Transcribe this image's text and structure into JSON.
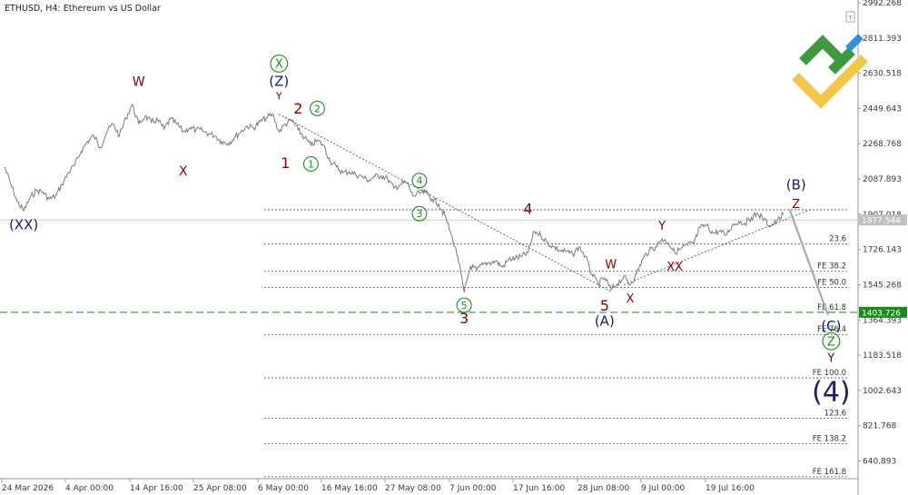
{
  "header": {
    "symbol": "ETHUSD",
    "timeframe": "H4",
    "description": "Ethereum vs US Dollar"
  },
  "colors": {
    "price": "#7a7a7a",
    "dark_red": "#8b0000",
    "navy": "#1a1a6e",
    "green": "#1e8a1e",
    "support_line": "#1a8a1a",
    "projection": "#a9a9a9",
    "logo_green": "#3f9a3f",
    "logo_yellow": "#f2c84b",
    "logo_blue": "#2f8fd8"
  },
  "chart_data": {
    "type": "line",
    "ylim": [
      578.0,
      2992.268
    ],
    "y_ticks": [
      "2992.268",
      "2811.393",
      "2630.518",
      "2449.643",
      "2268.768",
      "2087.893",
      "1907.018",
      "1726.143",
      "1545.268",
      "1364.393",
      "1183.518",
      "1002.643",
      "821.768",
      "640.893"
    ],
    "x_tick_labels": [
      "24 Mar 2026",
      "4 Apr 00:00",
      "14 Apr 16:00",
      "25 Apr 08:00",
      "6 May 00:00",
      "16 May 16:00",
      "27 May 08:00",
      "7 Jun 00:00",
      "17 Jun 16:00",
      "28 Jun 08:00",
      "9 Jul 00:00",
      "19 Jul 16:00"
    ],
    "current_price": "1877.544",
    "support_level": "1403.726",
    "price_series": [
      [
        "03-24 00:00",
        2150
      ],
      [
        "03-25 00:00",
        2060
      ],
      [
        "03-26 00:00",
        1970
      ],
      [
        "03-27 00:00",
        1925
      ],
      [
        "03-28 00:00",
        1990
      ],
      [
        "03-29 00:00",
        2030
      ],
      [
        "03-30 00:00",
        2020
      ],
      [
        "03-31 00:00",
        1985
      ],
      [
        "04-01 00:00",
        2000
      ],
      [
        "04-02 00:00",
        2060
      ],
      [
        "04-03 00:00",
        2120
      ],
      [
        "04-04 00:00",
        2160
      ],
      [
        "04-05 00:00",
        2230
      ],
      [
        "04-06 00:00",
        2280
      ],
      [
        "04-07 00:00",
        2310
      ],
      [
        "04-08 00:00",
        2250
      ],
      [
        "04-09 00:00",
        2330
      ],
      [
        "04-10 00:00",
        2370
      ],
      [
        "04-11 00:00",
        2310
      ],
      [
        "04-12 00:00",
        2400
      ],
      [
        "04-13 00:00",
        2470
      ],
      [
        "04-14 00:00",
        2370
      ],
      [
        "04-15 00:00",
        2410
      ],
      [
        "04-16 00:00",
        2380
      ],
      [
        "04-17 00:00",
        2390
      ],
      [
        "04-18 00:00",
        2345
      ],
      [
        "04-19 00:00",
        2395
      ],
      [
        "04-20 00:00",
        2370
      ],
      [
        "04-21 00:00",
        2330
      ],
      [
        "04-22 00:00",
        2350
      ],
      [
        "04-23 00:00",
        2340
      ],
      [
        "04-24 00:00",
        2335
      ],
      [
        "04-25 00:00",
        2320
      ],
      [
        "04-26 00:00",
        2310
      ],
      [
        "04-27 00:00",
        2280
      ],
      [
        "04-28 00:00",
        2270
      ],
      [
        "04-29 00:00",
        2300
      ],
      [
        "04-30 00:00",
        2330
      ],
      [
        "05-01 00:00",
        2360
      ],
      [
        "05-02 00:00",
        2350
      ],
      [
        "05-03 00:00",
        2380
      ],
      [
        "05-04 00:00",
        2400
      ],
      [
        "05-05 00:00",
        2420
      ],
      [
        "05-06 00:00",
        2330
      ],
      [
        "05-07 00:00",
        2370
      ],
      [
        "05-08 00:00",
        2390
      ],
      [
        "05-09 00:00",
        2340
      ],
      [
        "05-10 00:00",
        2300
      ],
      [
        "05-11 00:00",
        2260
      ],
      [
        "05-12 00:00",
        2285
      ],
      [
        "05-13 00:00",
        2260
      ],
      [
        "05-14 00:00",
        2180
      ],
      [
        "05-15 00:00",
        2150
      ],
      [
        "05-16 00:00",
        2120
      ],
      [
        "05-17 00:00",
        2125
      ],
      [
        "05-18 00:00",
        2110
      ],
      [
        "05-19 00:00",
        2100
      ],
      [
        "05-20 00:00",
        2080
      ],
      [
        "05-21 00:00",
        2100
      ],
      [
        "05-22 00:00",
        2105
      ],
      [
        "05-23 00:00",
        2090
      ],
      [
        "05-24 00:00",
        2040
      ],
      [
        "05-25 00:00",
        2060
      ],
      [
        "05-26 00:00",
        2070
      ],
      [
        "05-27 00:00",
        2000
      ],
      [
        "05-28 00:00",
        2015
      ],
      [
        "05-29 00:00",
        2020
      ],
      [
        "05-30 00:00",
        1985
      ],
      [
        "05-31 00:00",
        1960
      ],
      [
        "06-01 00:00",
        1900
      ],
      [
        "06-02 00:00",
        1800
      ],
      [
        "06-03 00:00",
        1690
      ],
      [
        "06-04 00:00",
        1505
      ],
      [
        "06-05 00:00",
        1640
      ],
      [
        "06-06 00:00",
        1620
      ],
      [
        "06-07 00:00",
        1650
      ],
      [
        "06-08 00:00",
        1660
      ],
      [
        "06-09 00:00",
        1665
      ],
      [
        "06-10 00:00",
        1635
      ],
      [
        "06-11 00:00",
        1675
      ],
      [
        "06-12 00:00",
        1680
      ],
      [
        "06-13 00:00",
        1690
      ],
      [
        "06-14 00:00",
        1710
      ],
      [
        "06-15 00:00",
        1820
      ],
      [
        "06-16 00:00",
        1800
      ],
      [
        "06-17 00:00",
        1760
      ],
      [
        "06-18 00:00",
        1740
      ],
      [
        "06-19 00:00",
        1720
      ],
      [
        "06-20 00:00",
        1715
      ],
      [
        "06-21 00:00",
        1700
      ],
      [
        "06-22 00:00",
        1740
      ],
      [
        "06-23 00:00",
        1690
      ],
      [
        "06-24 00:00",
        1600
      ],
      [
        "06-25 00:00",
        1550
      ],
      [
        "06-26 00:00",
        1580
      ],
      [
        "06-27 00:00",
        1520
      ],
      [
        "06-28 00:00",
        1550
      ],
      [
        "06-29 00:00",
        1585
      ],
      [
        "06-30 00:00",
        1545
      ],
      [
        "07-01 00:00",
        1600
      ],
      [
        "07-02 00:00",
        1680
      ],
      [
        "07-03 00:00",
        1720
      ],
      [
        "07-04 00:00",
        1740
      ],
      [
        "07-05 00:00",
        1780
      ],
      [
        "07-06 00:00",
        1760
      ],
      [
        "07-07 00:00",
        1710
      ],
      [
        "07-08 00:00",
        1730
      ],
      [
        "07-09 00:00",
        1750
      ],
      [
        "07-10 00:00",
        1760
      ],
      [
        "07-11 00:00",
        1840
      ],
      [
        "07-12 00:00",
        1850
      ],
      [
        "07-13 00:00",
        1810
      ],
      [
        "07-14 00:00",
        1820
      ],
      [
        "07-15 00:00",
        1800
      ],
      [
        "07-16 00:00",
        1850
      ],
      [
        "07-17 00:00",
        1870
      ],
      [
        "07-18 00:00",
        1860
      ],
      [
        "07-19 00:00",
        1890
      ],
      [
        "07-20 00:00",
        1910
      ],
      [
        "07-21 00:00",
        1880
      ],
      [
        "07-22 00:00",
        1845
      ],
      [
        "07-23 00:00",
        1870
      ],
      [
        "07-24 00:00",
        1905
      ]
    ],
    "fib_levels": [
      {
        "label": "",
        "value": 1930
      },
      {
        "label": "23.6",
        "value": 1754
      },
      {
        "label": "FE 38.2",
        "value": 1614
      },
      {
        "label": "FE 50.0",
        "value": 1531
      },
      {
        "label": "FE 61.8",
        "value": 1403.726
      },
      {
        "label": "FE 76.4",
        "value": 1290
      },
      {
        "label": "FE 100.0",
        "value": 1067
      },
      {
        "label": "123.6",
        "value": 860
      },
      {
        "label": "FE 138.2",
        "value": 730
      },
      {
        "label": "FE 161.8",
        "value": 560
      }
    ],
    "trendlines": [
      {
        "style": "dotted",
        "from": [
          "05-06 00:00",
          2420
        ],
        "to": [
          "06-27 00:00",
          1510
        ]
      },
      {
        "style": "dotted",
        "from": [
          "06-29 00:00",
          1545
        ],
        "to": [
          "07-28 12:00",
          1935
        ]
      },
      {
        "style": "projection",
        "from": [
          "07-25 00:00",
          1930
        ],
        "to": [
          "07-31 00:00",
          1390
        ]
      }
    ],
    "wave_labels": [
      {
        "text": "W",
        "color": "dark_red",
        "style": "text",
        "size": 14,
        "t": "04-14 00:00",
        "v": 2590
      },
      {
        "text": "X",
        "color": "dark_red",
        "style": "text",
        "size": 14,
        "t": "04-21 00:00",
        "v": 2130
      },
      {
        "text": "(XX)",
        "color": "navy",
        "style": "text",
        "size": 15,
        "t": "03-27 00:00",
        "v": 1855
      },
      {
        "text": "X",
        "color": "green",
        "style": "circle",
        "size": 13,
        "t": "05-06 00:00",
        "v": 2680
      },
      {
        "text": "(Z)",
        "color": "navy",
        "style": "text",
        "size": 15,
        "t": "05-06 00:00",
        "v": 2590
      },
      {
        "text": "Y",
        "color": "dark_red",
        "style": "text",
        "size": 11,
        "t": "05-06 00:00",
        "v": 2515
      },
      {
        "text": "2",
        "color": "dark_red",
        "style": "text",
        "size": 16,
        "t": "05-09 00:00",
        "v": 2450
      },
      {
        "text": "2",
        "color": "green",
        "style": "circle",
        "size": 11,
        "t": "05-12 00:00",
        "v": 2450
      },
      {
        "text": "1",
        "color": "dark_red",
        "style": "text",
        "size": 16,
        "t": "05-07 00:00",
        "v": 2170
      },
      {
        "text": "1",
        "color": "green",
        "style": "circle",
        "size": 11,
        "t": "05-11 00:00",
        "v": 2165
      },
      {
        "text": "4",
        "color": "green",
        "style": "circle",
        "size": 11,
        "t": "05-28 00:00",
        "v": 2080
      },
      {
        "text": "3",
        "color": "green",
        "style": "circle",
        "size": 11,
        "t": "05-28 00:00",
        "v": 1910
      },
      {
        "text": "4",
        "color": "dark_red",
        "style": "text",
        "size": 16,
        "t": "06-14 00:00",
        "v": 1935
      },
      {
        "text": "5",
        "color": "green",
        "style": "circle",
        "size": 11,
        "t": "06-04 00:00",
        "v": 1440
      },
      {
        "text": "3",
        "color": "dark_red",
        "style": "text",
        "size": 16,
        "t": "06-04 00:00",
        "v": 1375
      },
      {
        "text": "W",
        "color": "dark_red",
        "style": "text",
        "size": 13,
        "t": "06-27 00:00",
        "v": 1650
      },
      {
        "text": "5",
        "color": "dark_red",
        "style": "text",
        "size": 16,
        "t": "06-26 00:00",
        "v": 1440
      },
      {
        "text": "X",
        "color": "dark_red",
        "style": "text",
        "size": 13,
        "t": "06-30 00:00",
        "v": 1475
      },
      {
        "text": "(A)",
        "color": "navy",
        "style": "text",
        "size": 15,
        "t": "06-26 00:00",
        "v": 1360
      },
      {
        "text": "Y",
        "color": "dark_red",
        "style": "text",
        "size": 13,
        "t": "07-05 00:00",
        "v": 1850
      },
      {
        "text": "XX",
        "color": "dark_red",
        "style": "text",
        "size": 13,
        "t": "07-07 00:00",
        "v": 1640
      },
      {
        "text": "(B)",
        "color": "navy",
        "style": "text",
        "size": 15,
        "t": "07-26 00:00",
        "v": 2060
      },
      {
        "text": "Z",
        "color": "dark_red",
        "style": "text",
        "size": 13,
        "t": "07-26 00:00",
        "v": 1960
      },
      {
        "text": "(C)",
        "color": "navy",
        "style": "text",
        "size": 15,
        "t": "07-31 12:00",
        "v": 1335
      },
      {
        "text": "Z",
        "color": "green",
        "style": "circle",
        "size": 13,
        "t": "07-31 12:00",
        "v": 1255
      },
      {
        "text": "Y",
        "color": "dark_red",
        "style": "text",
        "size": 13,
        "t": "07-31 12:00",
        "v": 1170
      },
      {
        "text": "(4)",
        "color": "navy",
        "style": "text",
        "size": 30,
        "t": "07-31 12:00",
        "v": 1000
      }
    ]
  }
}
